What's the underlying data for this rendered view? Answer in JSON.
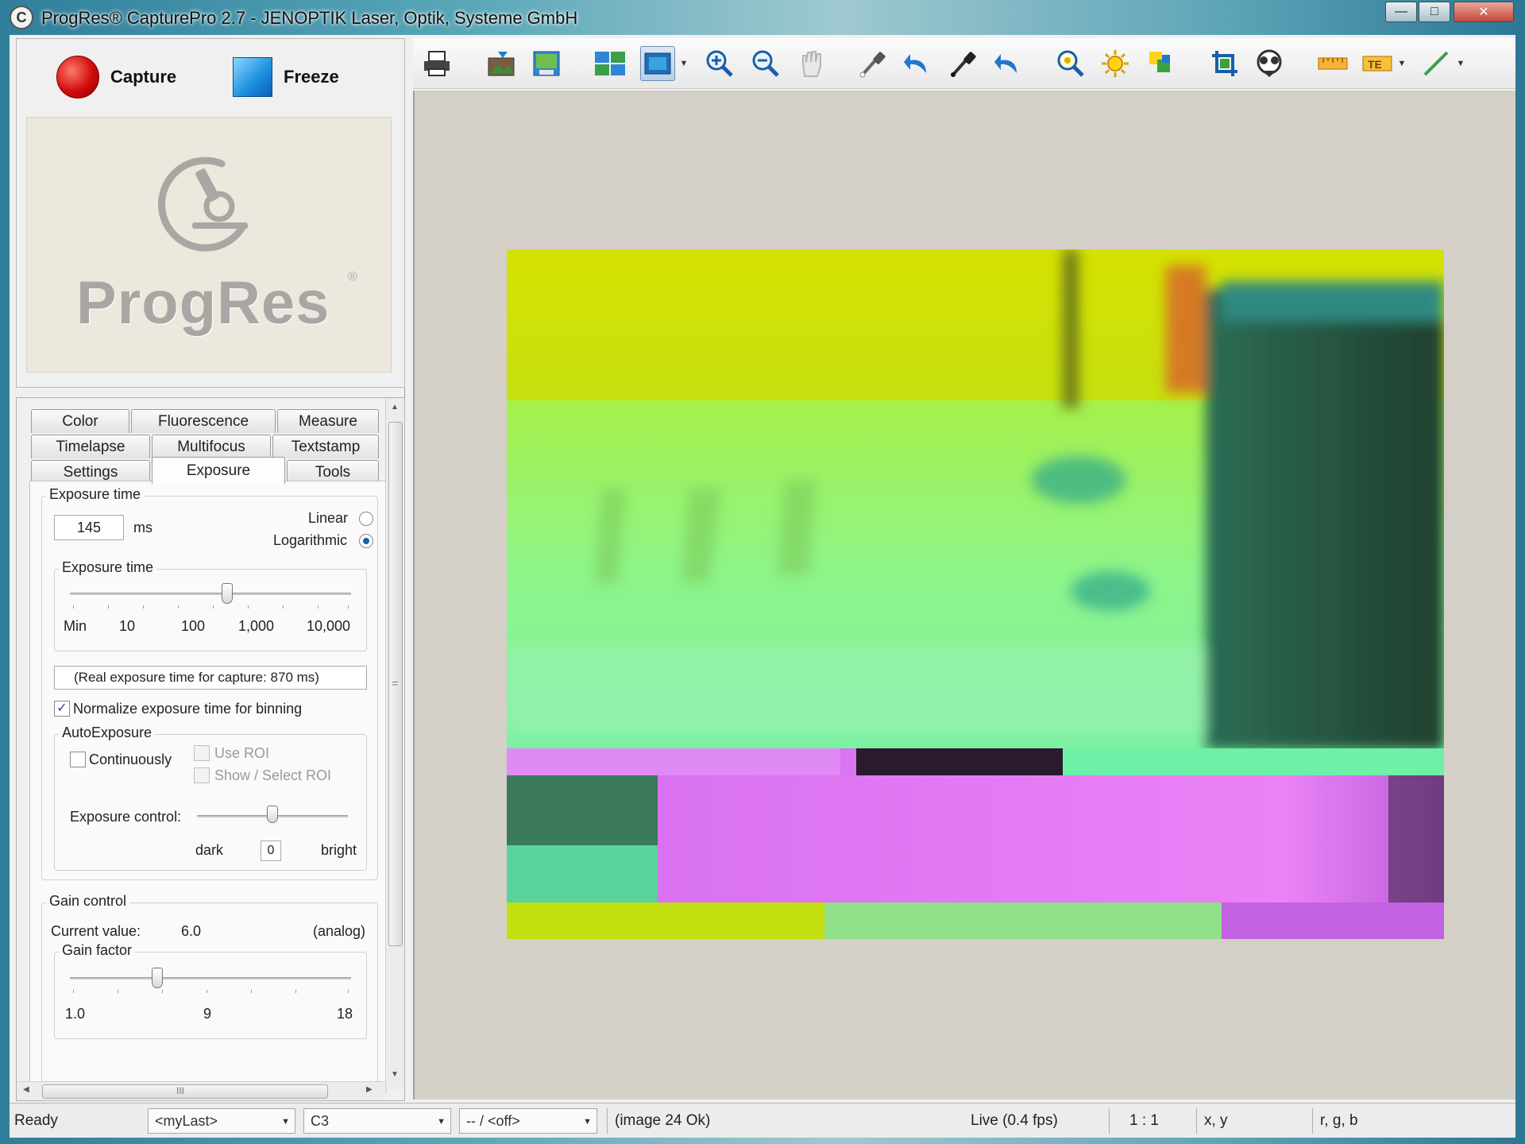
{
  "window": {
    "title": "ProgRes® CapturePro 2.7 - JENOPTIK Laser, Optik, Systeme GmbH",
    "icon_letter": "C",
    "controls": {
      "minimize": "—",
      "maximize": "□",
      "close": "✕"
    }
  },
  "capture_area": {
    "capture_label": "Capture",
    "freeze_label": "Freeze",
    "logo_text": "ProgRes",
    "logo_mark": "®",
    "colors": {
      "capture": "#d10b0b",
      "freeze": "#1b8ee0"
    }
  },
  "tabs": [
    {
      "label": "Color"
    },
    {
      "label": "Fluorescence"
    },
    {
      "label": "Measure"
    },
    {
      "label": "Timelapse"
    },
    {
      "label": "Multifocus"
    },
    {
      "label": "Textstamp"
    },
    {
      "label": "Settings"
    },
    {
      "label": "Exposure",
      "active": true
    },
    {
      "label": "Tools"
    }
  ],
  "exposure": {
    "group_title": "Exposure time",
    "value": "145",
    "unit": "ms",
    "linear_label": "Linear",
    "log_label": "Logarithmic",
    "scale_mode": "logarithmic",
    "slider_title": "Exposure time",
    "slider_labels": [
      "Min",
      "10",
      "100",
      "1,000",
      "10,000"
    ],
    "slider_position_fraction": 0.56,
    "real_exposure_text": "(Real exposure time for capture: 870 ms)",
    "normalize_label": "Normalize exposure time for binning",
    "normalize_checked": true,
    "auto": {
      "title": "AutoExposure",
      "continuously_label": "Continuously",
      "use_roi_label": "Use ROI",
      "show_roi_label": "Show / Select ROI",
      "control_label": "Exposure control:",
      "dark_label": "dark",
      "bright_label": "bright",
      "control_value": "0",
      "control_position_fraction": 0.5
    }
  },
  "gain": {
    "group_title": "Gain control",
    "current_label": "Current value:",
    "current_value": "6.0",
    "mode": "(analog)",
    "factor_title": "Gain factor",
    "labels": [
      "1.0",
      "9",
      "18"
    ],
    "position_fraction": 0.31
  },
  "toolbar": {
    "icons": [
      "print-icon",
      "open-image-icon",
      "save-image-icon",
      "split-view-icon",
      "live-view-icon",
      "zoom-in-icon",
      "zoom-out-icon",
      "pan-hand-icon",
      "white-balance-pipette-icon",
      "undo-white-balance-icon",
      "black-balance-pipette-icon",
      "undo-black-balance-icon",
      "search-roi-icon",
      "auto-brightness-icon",
      "auto-color-icon",
      "crop-icon",
      "camera-settings-icon",
      "ruler-icon",
      "text-stamp-icon",
      "line-tool-icon"
    ]
  },
  "statusbar": {
    "ready": "Ready",
    "profile": "<myLast>",
    "camera": "C3",
    "mode": "-- / <off>",
    "image_status": "(image 24 Ok)",
    "live": "Live (0.4 fps)",
    "zoom": "1 : 1",
    "coords": "x, y",
    "rgb": "r, g, b"
  },
  "scrollbar": {
    "hscroll_label": "III",
    "vscroll_grip": "="
  }
}
